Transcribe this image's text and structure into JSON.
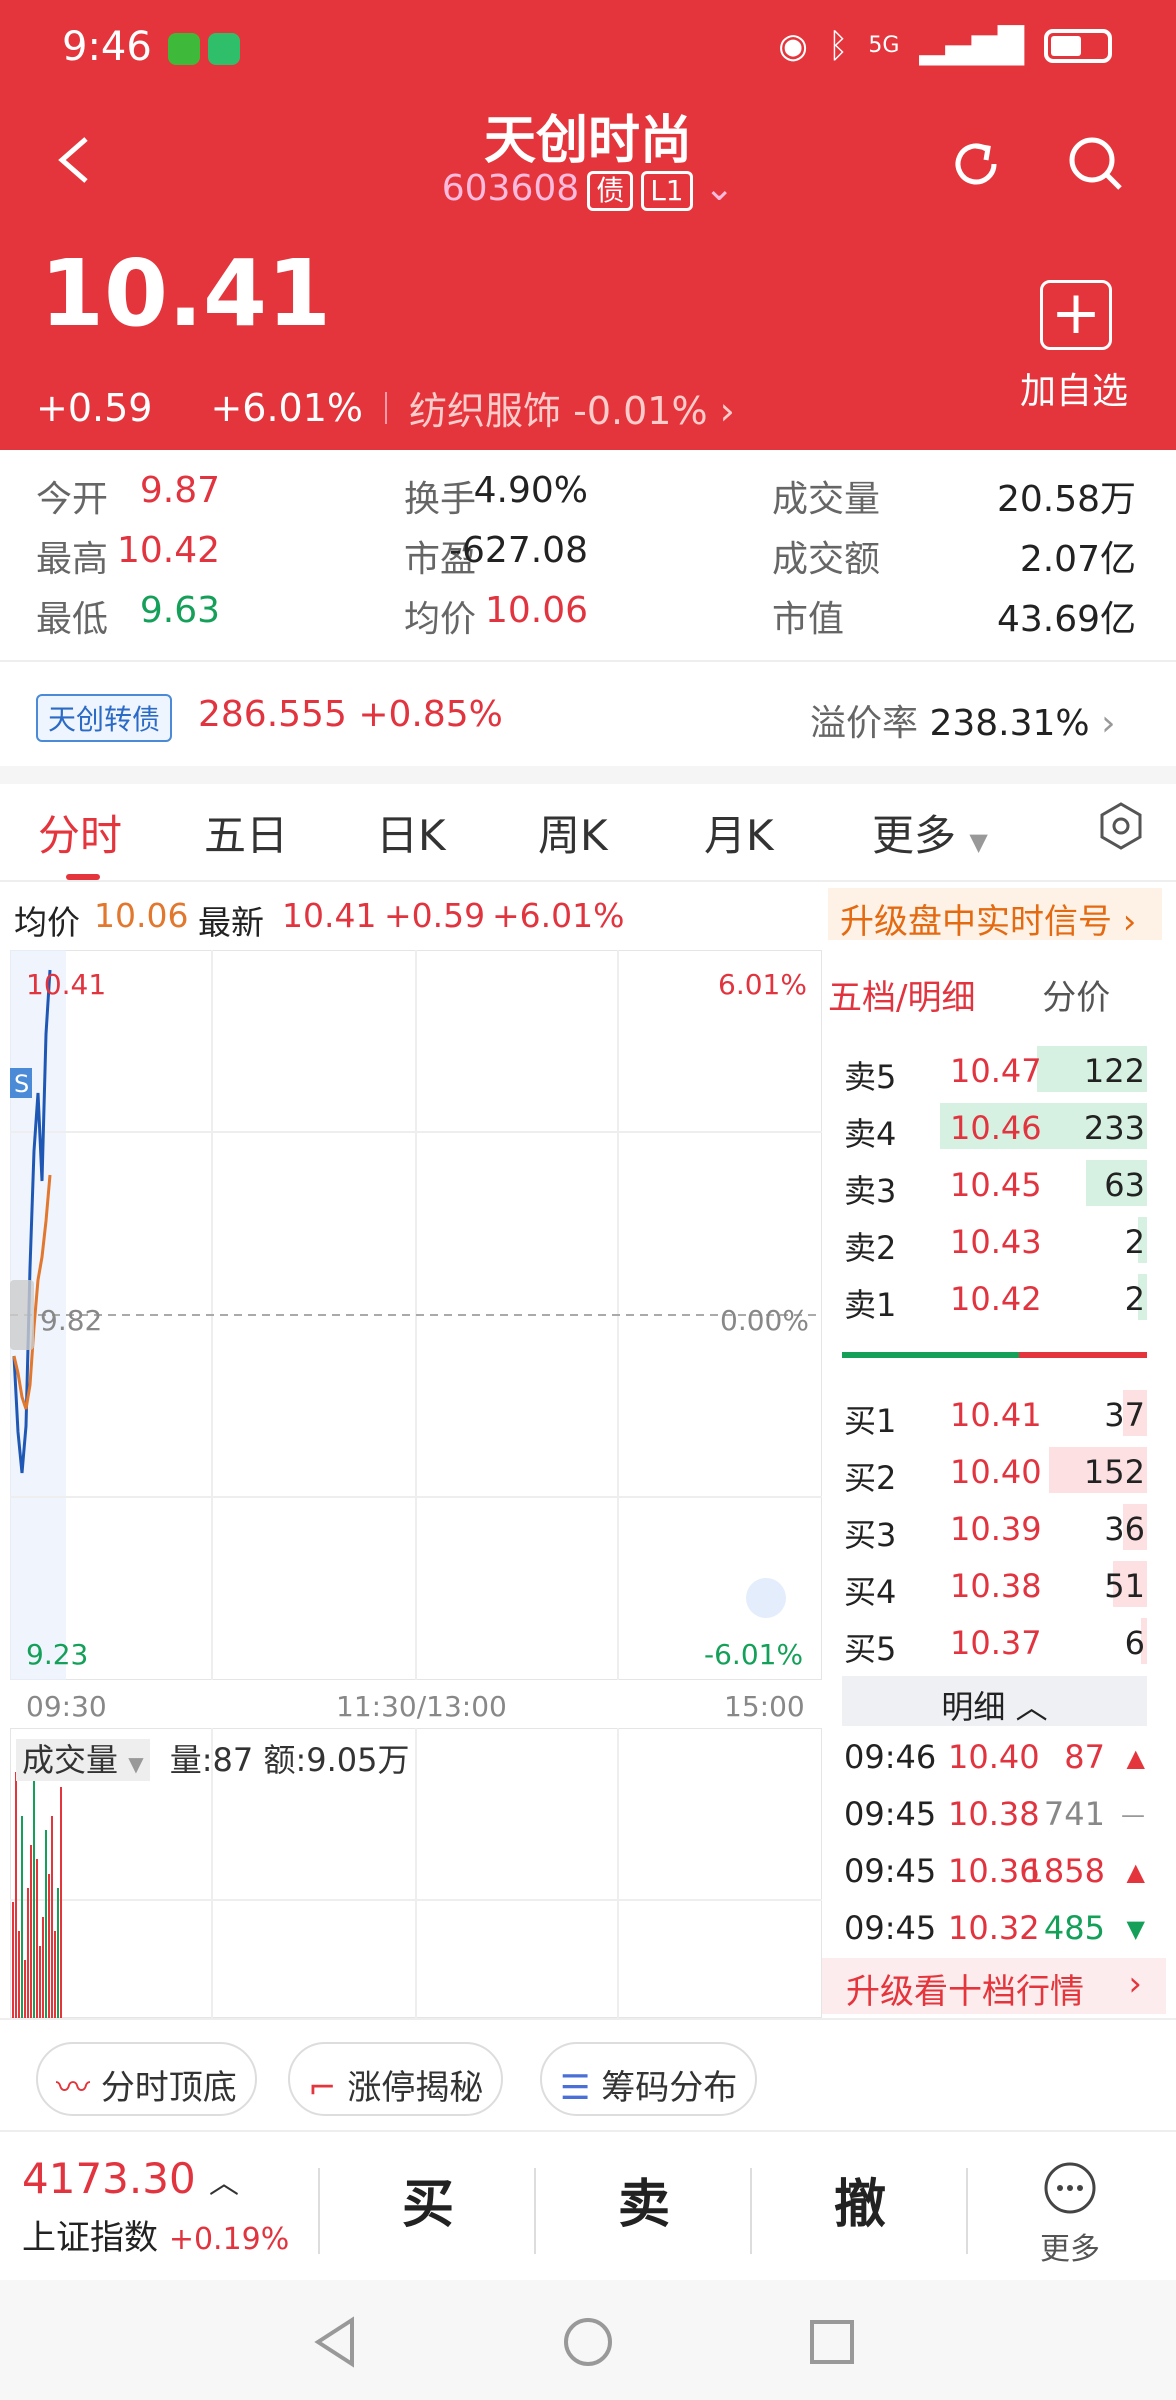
{
  "status": {
    "time": "9:46",
    "network": "5G"
  },
  "header": {
    "title": "天创时尚",
    "code": "603608",
    "tag_bond": "债",
    "tag_level": "L1",
    "price": "10.41",
    "change": "+0.59",
    "change_pct": "+6.01%",
    "industry": "纺织服饰",
    "industry_pct": "-0.01%",
    "add_label": "加自选"
  },
  "stats": [
    [
      {
        "k": "今开",
        "v": "9.87",
        "c": "red"
      },
      {
        "k": "换手",
        "v": "4.90%",
        "c": ""
      },
      {
        "k": "成交量",
        "v": "20.58万",
        "c": ""
      }
    ],
    [
      {
        "k": "最高",
        "v": "10.42",
        "c": "red"
      },
      {
        "k": "市盈",
        "v": "-627.08",
        "c": ""
      },
      {
        "k": "成交额",
        "v": "2.07亿",
        "c": ""
      }
    ],
    [
      {
        "k": "最低",
        "v": "9.63",
        "c": "green"
      },
      {
        "k": "均价",
        "v": "10.06",
        "c": "red"
      },
      {
        "k": "市值",
        "v": "43.69亿",
        "c": ""
      }
    ]
  ],
  "bond": {
    "tag": "天创转债",
    "value": "286.555",
    "pct": "+0.85%",
    "premium_label": "溢价率",
    "premium": "238.31%"
  },
  "tabs": [
    "分时",
    "五日",
    "日K",
    "周K",
    "月K",
    "更多"
  ],
  "info": {
    "avg_label": "均价",
    "avg": "10.06",
    "latest_label": "最新",
    "latest": "10.41",
    "chg": "+0.59",
    "pct": "+6.01%",
    "upgrade": "升级盘中实时信号"
  },
  "chart": {
    "top": "10.41",
    "top_pct": "6.01%",
    "mid": "9.82",
    "mid_pct": "0.00%",
    "bottom": "9.23",
    "bottom_pct": "-6.01%",
    "t_start": "09:30",
    "t_mid": "11:30/13:00",
    "t_end": "15:00",
    "marker": "S"
  },
  "chart_data": {
    "type": "line",
    "y_range": [
      9.23,
      10.41
    ],
    "prev_close": 9.82,
    "series": [
      {
        "values": [
          9.75,
          9.62,
          9.55,
          9.63,
          9.9,
          10.1,
          10.2,
          10.05,
          10.3,
          10.41
        ]
      },
      {
        "values": [
          9.75,
          9.72,
          9.68,
          9.66,
          9.7,
          9.8,
          9.88,
          9.92,
          9.98,
          10.06
        ]
      }
    ],
    "volume": [
      40,
      85,
      30,
      70,
      20,
      45,
      60,
      90,
      55,
      25,
      35,
      65,
      50,
      70,
      30,
      45,
      80
    ]
  },
  "volume": {
    "label": "成交量",
    "qty_label": "量:87",
    "amt_label": "额:9.05万"
  },
  "orderbook": {
    "title": "五档/明细",
    "split": "分价",
    "asks": [
      {
        "l": "卖5",
        "p": "10.47",
        "q": "122",
        "w": 0.36
      },
      {
        "l": "卖4",
        "p": "10.46",
        "q": "233",
        "w": 0.68
      },
      {
        "l": "卖3",
        "p": "10.45",
        "q": "63",
        "w": 0.2
      },
      {
        "l": "卖2",
        "p": "10.43",
        "q": "2",
        "w": 0.03
      },
      {
        "l": "卖1",
        "p": "10.42",
        "q": "2",
        "w": 0.03
      }
    ],
    "bids": [
      {
        "l": "买1",
        "p": "10.41",
        "q": "37",
        "w": 0.08
      },
      {
        "l": "买2",
        "p": "10.40",
        "q": "152",
        "w": 0.32
      },
      {
        "l": "买3",
        "p": "10.39",
        "q": "36",
        "w": 0.08
      },
      {
        "l": "买4",
        "p": "10.38",
        "q": "51",
        "w": 0.11
      },
      {
        "l": "买5",
        "p": "10.37",
        "q": "6",
        "w": 0.02
      }
    ]
  },
  "detail": {
    "title": "明细",
    "rows": [
      {
        "t": "09:46",
        "p": "10.40",
        "q": "87",
        "d": "up"
      },
      {
        "t": "09:45",
        "p": "10.38",
        "q": "741",
        "d": "flat"
      },
      {
        "t": "09:45",
        "p": "10.36",
        "q": "1858",
        "d": "up"
      },
      {
        "t": "09:45",
        "p": "10.32",
        "q": "485",
        "d": "down"
      }
    ],
    "upgrade": "升级看十档行情"
  },
  "pills": [
    "分时顶底",
    "涨停揭秘",
    "筹码分布"
  ],
  "bottom": {
    "index_value": "4173.30",
    "index_name": "上证指数",
    "index_pct": "+0.19%",
    "buy": "买",
    "sell": "卖",
    "cancel": "撤",
    "more": "更多"
  }
}
